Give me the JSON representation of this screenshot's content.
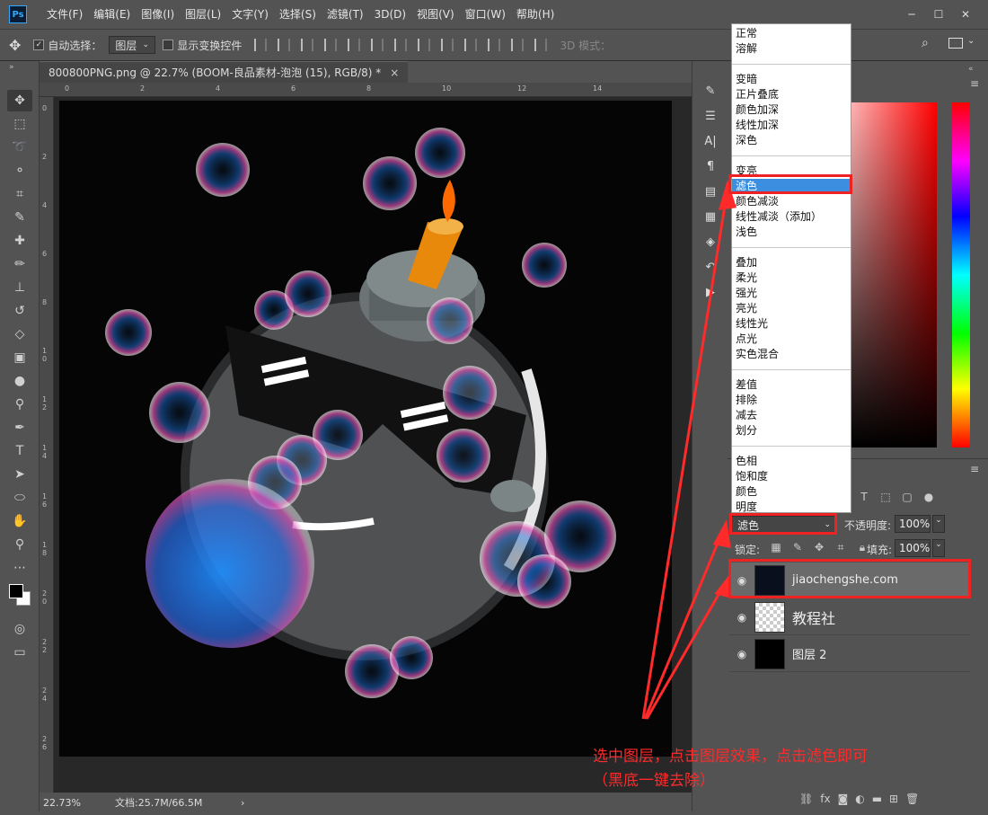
{
  "app": {
    "logo": "Ps"
  },
  "menu": [
    "文件(F)",
    "编辑(E)",
    "图像(I)",
    "图层(L)",
    "文字(Y)",
    "选择(S)",
    "滤镜(T)",
    "3D(D)",
    "视图(V)",
    "窗口(W)",
    "帮助(H)"
  ],
  "window_controls": [
    "─",
    "☐",
    "✕"
  ],
  "options": {
    "auto_select_label": "自动选择：",
    "auto_select_checked": true,
    "auto_select_target": "图层",
    "show_transform_label": "显示变换控件",
    "mode_3d_label": "3D 模式："
  },
  "document": {
    "tab_title": "800800PNG.png @ 22.7% (BOOM-良品素材-泡泡 (15), RGB/8) *",
    "close": "×"
  },
  "ruler": {
    "top": [
      "0",
      "2",
      "4",
      "6",
      "8",
      "10",
      "12",
      "14"
    ],
    "left": [
      "0",
      "2",
      "4",
      "6",
      "8",
      "1 0",
      "1 2",
      "1 4",
      "1 6",
      "1 8",
      "2 0",
      "2 2",
      "2 4",
      "2 6"
    ]
  },
  "status": {
    "zoom": "22.73%",
    "doc": "文档:25.7M/66.5M",
    "arrow": "›"
  },
  "blend_menu": {
    "groups": [
      [
        "正常",
        "溶解"
      ],
      [
        "变暗",
        "正片叠底",
        "颜色加深",
        "线性加深",
        "深色"
      ],
      [
        "变亮",
        "滤色",
        "颜色减淡",
        "线性减淡（添加）",
        "浅色"
      ],
      [
        "叠加",
        "柔光",
        "强光",
        "亮光",
        "线性光",
        "点光",
        "实色混合"
      ],
      [
        "差值",
        "排除",
        "减去",
        "划分"
      ],
      [
        "色相",
        "饱和度",
        "颜色",
        "明度"
      ]
    ],
    "highlighted": "滤色"
  },
  "layers_panel": {
    "blend_mode": "滤色",
    "opacity_label": "不透明度:",
    "opacity_value": "100%",
    "lock_label": "锁定:",
    "fill_label": "填充:",
    "fill_value": "100%",
    "layers": [
      {
        "name": "jiaochengshe.com",
        "selected": true
      },
      {
        "name": "教程社",
        "selected": false
      },
      {
        "name": "图层 2",
        "selected": false
      }
    ]
  },
  "annotation": {
    "line1": "选中图层，点击图层效果，点击滤色即可",
    "line2": "（黑底一键去除）"
  },
  "colors": {
    "accent_red": "#ee2222",
    "highlight_blue": "#3b8ee0",
    "panel_bg": "#535353"
  }
}
